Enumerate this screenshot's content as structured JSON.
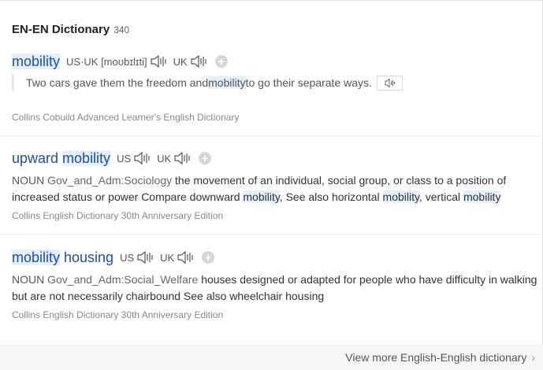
{
  "section": {
    "title": "EN-EN Dictionary",
    "count": "340"
  },
  "entries": [
    {
      "headword_parts": [
        "mobility"
      ],
      "pron_us_label": "US·UK [moʊbɪlɪti]",
      "pron_uk_label": "UK",
      "example_parts": [
        "Two cars gave them the freedom and ",
        "mobility",
        " to go their separate ways."
      ],
      "source": "Collins Cobuild Advanced Learner's English Dictionary"
    },
    {
      "headword_parts": [
        "upward ",
        "mobility"
      ],
      "pron_us_label": "US",
      "pron_uk_label": "UK",
      "pos": "NOUN",
      "domain": "Gov_and_Adm:Sociology",
      "definition_parts": [
        "the movement of an individual, social group, or class to a position of increased status or power Compare downward ",
        "mobility",
        ", See also horizontal ",
        "mobility",
        ", vertical ",
        "mobility"
      ],
      "source": "Collins English Dictionary 30th Anniversary Edition"
    },
    {
      "headword_parts": [
        "mobility",
        " housing"
      ],
      "pron_us_label": "US",
      "pron_uk_label": "UK",
      "pos": "NOUN",
      "domain": "Gov_and_Adm:Social_Welfare",
      "definition_parts": [
        "houses designed or adapted for people who have difficulty in walking but are not necessarily chairbound See also wheelchair housing"
      ],
      "source": "Collins English Dictionary 30th Anniversary Edition"
    }
  ],
  "footer": {
    "view_more": "View more English-English dictionary"
  },
  "icons": {
    "speaker": "speaker-icon",
    "add": "plus-icon",
    "chevron": "chevron-right-icon"
  },
  "colors": {
    "headword": "#1f4e9c",
    "highlight": "#e4eefc"
  }
}
